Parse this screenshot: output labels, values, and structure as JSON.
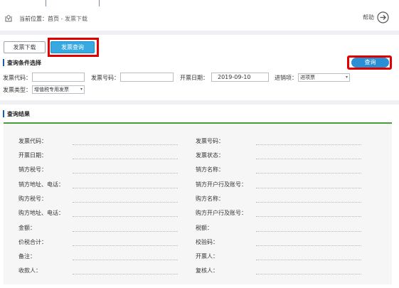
{
  "breadcrumb": {
    "prefix": "当前位置：",
    "home": "首页",
    "separator": " - ",
    "current": "发票下载"
  },
  "help": {
    "label": "帮助"
  },
  "tabs": [
    {
      "label": "发票下载",
      "active": false
    },
    {
      "label": "发票查询",
      "active": true
    }
  ],
  "conditions": {
    "title": "查询条件选择",
    "query_button": "查询",
    "invoice_code_label": "发票代码：",
    "invoice_code_value": "",
    "invoice_number_label": "发票号码：",
    "invoice_number_value": "",
    "date_label": "开票日期：",
    "date_value": "2019-09-10",
    "direction_label": "进销项：",
    "direction_value": "进项票",
    "type_label": "发票类型：",
    "type_value": "增值税专用发票"
  },
  "results": {
    "title": "查询结果",
    "left_labels": [
      "发票代码：",
      "开票日期：",
      "销方税号：",
      "销方地址、电话：",
      "购方税号：",
      "购方地址、电话：",
      "金额：",
      "价税合计：",
      "备注：",
      "收款人："
    ],
    "right_labels": [
      "发票号码：",
      "发票状态：",
      "销方名称：",
      "销方开户行及账号：",
      "购方名称：",
      "购方开户行及账号：",
      "税额：",
      "校验码：",
      "开票人：",
      "复核人："
    ]
  },
  "colors": {
    "accent_blue": "#36a9e1",
    "highlight_red": "#e00000",
    "result_border_green": "#4a9a3a",
    "section_bar_blue": "#1d5ea8"
  },
  "icons": {
    "breadcrumb": "location-marker-icon",
    "help": "arrow-circle-right-icon"
  }
}
